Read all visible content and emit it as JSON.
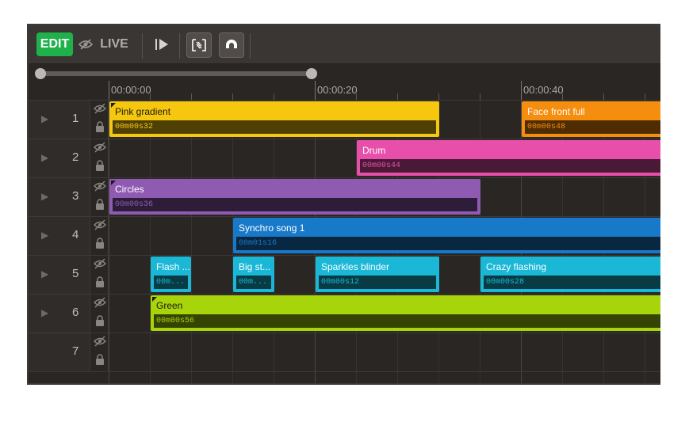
{
  "toolbar": {
    "edit_label": "EDIT",
    "live_label": "LIVE",
    "icons": [
      "eye-off-icon",
      "play-icon",
      "area-select-icon",
      "magnet-icon"
    ]
  },
  "ruler": {
    "labels": [
      "00:00:00",
      "00:00:20",
      "00:00:40"
    ]
  },
  "tracks": [
    {
      "number": "1"
    },
    {
      "number": "2"
    },
    {
      "number": "3"
    },
    {
      "number": "4"
    },
    {
      "number": "5"
    },
    {
      "number": "6"
    },
    {
      "number": "7"
    }
  ],
  "clips": [
    {
      "track": 1,
      "title": "Pink gradient",
      "duration": "00m00s32",
      "color": "#f6c70f"
    },
    {
      "track": 1,
      "title": "Face front full",
      "duration": "00m00s48",
      "color": "#f58d0e"
    },
    {
      "track": 2,
      "title": "Drum",
      "duration": "00m00s44",
      "color": "#e84faa"
    },
    {
      "track": 3,
      "title": "Circles",
      "duration": "00m00s36",
      "color": "#8f5ab2"
    },
    {
      "track": 4,
      "title": "Synchro song 1",
      "duration": "00m01s16",
      "color": "#1879c9"
    },
    {
      "track": 5,
      "title": "Flash ...",
      "duration": "00m...",
      "color": "#1ab7d6"
    },
    {
      "track": 5,
      "title": "Big st...",
      "duration": "00m...",
      "color": "#1ab7d6"
    },
    {
      "track": 5,
      "title": "Sparkles blinder",
      "duration": "00m00s12",
      "color": "#1ab7d6"
    },
    {
      "track": 5,
      "title": "Crazy flashing",
      "duration": "00m00s28",
      "color": "#1ab7d6"
    },
    {
      "track": 6,
      "title": "Green",
      "duration": "00m00s56",
      "color": "#a7d40a"
    }
  ]
}
